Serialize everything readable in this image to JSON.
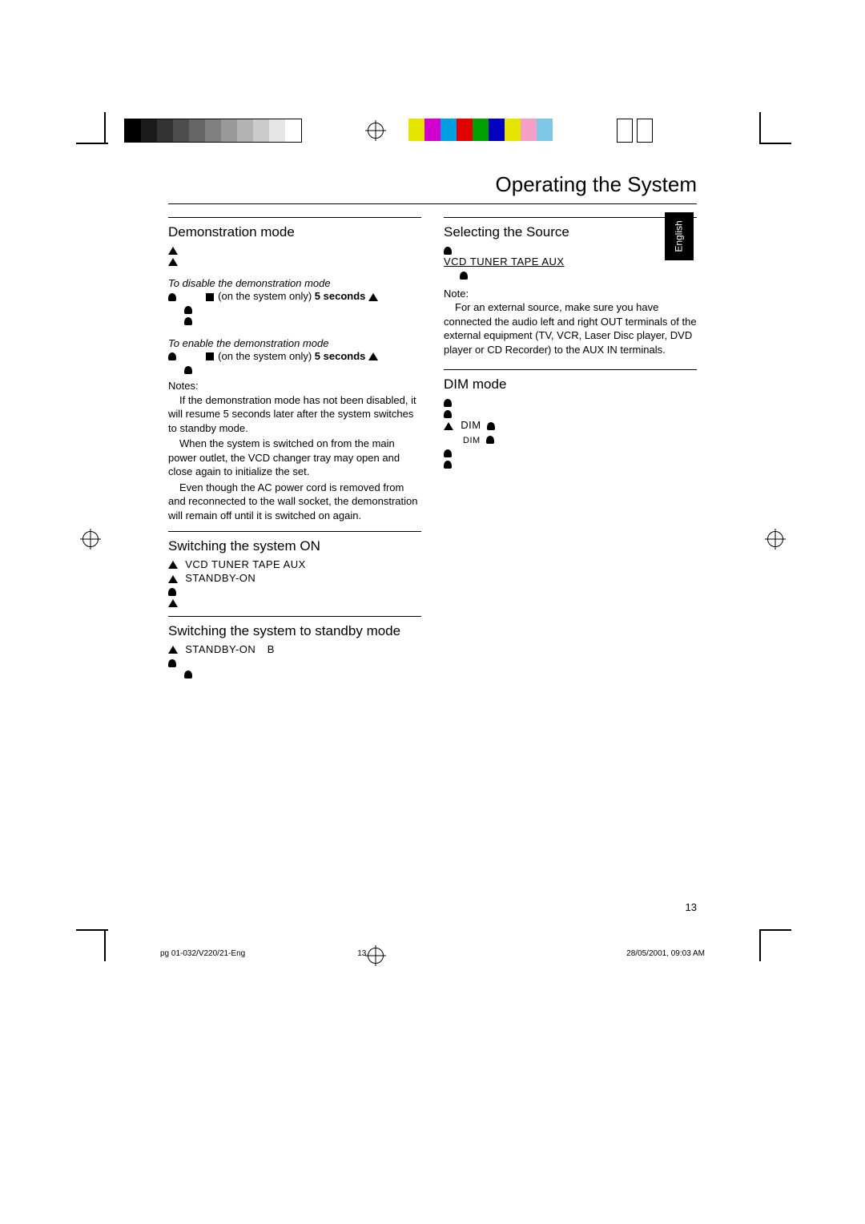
{
  "page_title": "Operating the System",
  "language_tab": "English",
  "page_number": "13",
  "footer": {
    "left": "pg 01-032/V220/21-Eng",
    "center": "13",
    "right": "28/05/2001, 09:03 AM"
  },
  "left_column": {
    "s1_title": "Demonstration mode",
    "s1_disable_heading": "To disable the demonstration mode",
    "s1_disable_step_a": " (on the system only) ",
    "s1_disable_step_b": "5 seconds",
    "s1_enable_heading": "To enable the demonstration mode",
    "s1_enable_step_a": " (on the system only) ",
    "s1_enable_step_b": "5 seconds",
    "notes_label": "Notes:",
    "note1": "If the demonstration mode has not been disabled, it will resume 5 seconds later after the system switches to standby mode.",
    "note2": "When the system is switched on from the main power outlet, the VCD changer tray may open and close again to initialize the set.",
    "note3": "Even though the AC power cord is removed from and reconnected to the wall socket, the demonstration will remain off until it is switched on again.",
    "s2_title": "Switching the system ON",
    "s2_sources": "VCD  TUNER  TAPE      AUX",
    "s2_standby": "STANDBY-ON",
    "s3_title": "Switching the system to standby mode",
    "s3_standby": "STANDBY-ON",
    "s3_b": "B"
  },
  "right_column": {
    "s4_title": "Selecting the Source",
    "s4_sources": "VCD  TUNER  TAPE      AUX",
    "s4_note_label": "Note:",
    "s4_note": "For an external source, make sure you have connected the audio left and right OUT terminals of the external equipment (TV, VCR, Laser Disc player, DVD player or CD Recorder) to the AUX IN terminals.",
    "s5_title": "DIM mode",
    "s5_dim1": "DIM",
    "s5_dim2": "DIM"
  },
  "printer_marks": {
    "gray_levels": [
      "#000000",
      "#1a1a1a",
      "#333333",
      "#4d4d4d",
      "#666666",
      "#808080",
      "#999999",
      "#b3b3b3",
      "#cccccc",
      "#e6e6e6",
      "#ffffff"
    ],
    "colors": [
      "#e5e500",
      "#d100d1",
      "#00a0e0",
      "#e00000",
      "#00a000",
      "#0000c0",
      "#e5e500",
      "#f5a1c7",
      "#7bc7e5"
    ]
  }
}
